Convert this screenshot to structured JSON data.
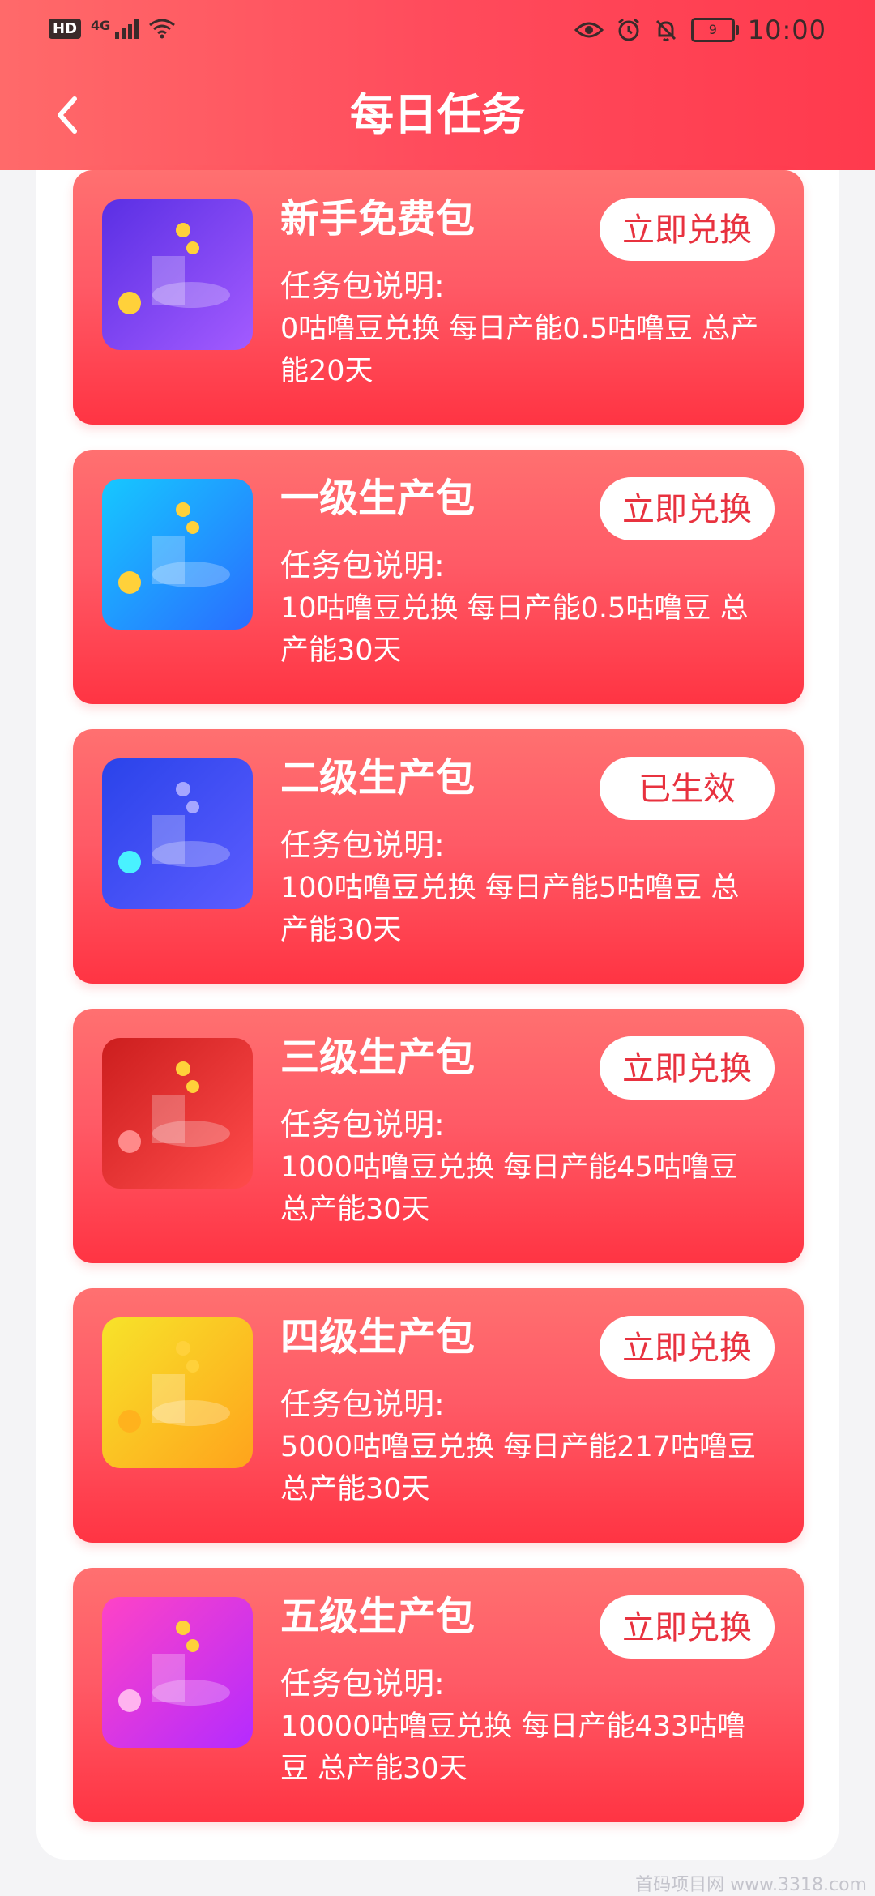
{
  "status_bar": {
    "left": {
      "hd": "HD",
      "network": "4G"
    },
    "right": {
      "battery": "9",
      "time": "10:00"
    }
  },
  "header": {
    "title": "每日任务"
  },
  "cards": [
    {
      "title": "新手免费包",
      "desc_label": "任务包说明:",
      "desc": "0咕噜豆兑换 每日产能0.5咕噜豆 总产能20天",
      "button": "立即兑换",
      "thumb_colors": [
        "#4b2bd8",
        "#9b4dff"
      ]
    },
    {
      "title": "一级生产包",
      "desc_label": "任务包说明:",
      "desc": "10咕噜豆兑换 每日产能0.5咕噜豆 总产能30天",
      "button": "立即兑换",
      "thumb_colors": [
        "#14b8ff",
        "#2f6bff"
      ]
    },
    {
      "title": "二级生产包",
      "desc_label": "任务包说明:",
      "desc": "100咕噜豆兑换 每日产能5咕噜豆 总产能30天",
      "button": "已生效",
      "thumb_colors": [
        "#2840e8",
        "#5b5bff"
      ]
    },
    {
      "title": "三级生产包",
      "desc_label": "任务包说明:",
      "desc": "1000咕噜豆兑换 每日产能45咕噜豆 总产能30天",
      "button": "立即兑换",
      "thumb_colors": [
        "#c61b1b",
        "#ff3f3f"
      ]
    },
    {
      "title": "四级生产包",
      "desc_label": "任务包说明:",
      "desc": "5000咕噜豆兑换 每日产能217咕噜豆 总产能30天",
      "button": "立即兑换",
      "thumb_colors": [
        "#f6df1d",
        "#ff9f1c"
      ]
    },
    {
      "title": "五级生产包",
      "desc_label": "任务包说明:",
      "desc": "10000咕噜豆兑换 每日产能433咕噜豆 总产能30天",
      "button": "立即兑换",
      "thumb_colors": [
        "#ff3fbf",
        "#b82bff"
      ]
    }
  ],
  "watermark": "首码项目网 www.3318.com"
}
